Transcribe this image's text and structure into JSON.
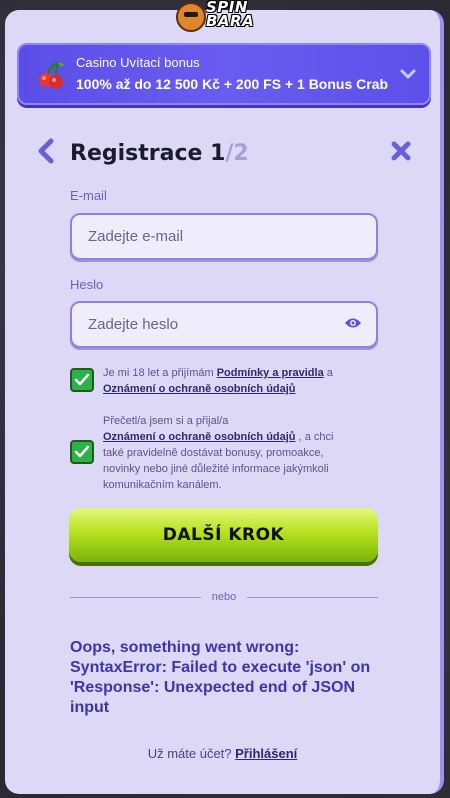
{
  "brand": {
    "logo_line1": "SPIN",
    "logo_line2": "BARA"
  },
  "bonus": {
    "title": "Casino Uvítací bonus",
    "text": "100% až do 12 500 Kč + 200 FS + 1 Bonus Crab"
  },
  "header": {
    "title": "Registrace 1",
    "step_total": "/2"
  },
  "form": {
    "email_label": "E-mail",
    "email_placeholder": "Zadejte e-mail",
    "password_label": "Heslo",
    "password_placeholder": "Zadejte heslo"
  },
  "consents": [
    {
      "checked": true,
      "text_before": "Je mi 18 let a přijímám ",
      "link1": "Podmínky a pravidla",
      "text_mid": " a ",
      "link2": "Oznámení o ochraně osobních údajů"
    },
    {
      "checked": true,
      "text_before": "Přečetl/a jsem si a přijal/a ",
      "link1": "Oznámení o ochraně osobních údajů",
      "text_after": " , a chci také pravidelně dostávat bonusy, promoakce, novinky nebo jiné důležité informace jakýmkoli komunikačním kanálem."
    }
  ],
  "actions": {
    "next_label": "DALŠÍ KROK",
    "or_label": "nebo"
  },
  "error": "Oops, something went wrong: SyntaxError: Failed to execute 'json' on 'Response': Unexpected end of JSON input",
  "footer": {
    "question": "Už máte účet? ",
    "login_link": "Přihlášení"
  },
  "colors": {
    "accent": "#5a4ee8",
    "button": "#b6e21f",
    "checkbox": "#2fb14a",
    "panel": "#dcd8f6"
  }
}
